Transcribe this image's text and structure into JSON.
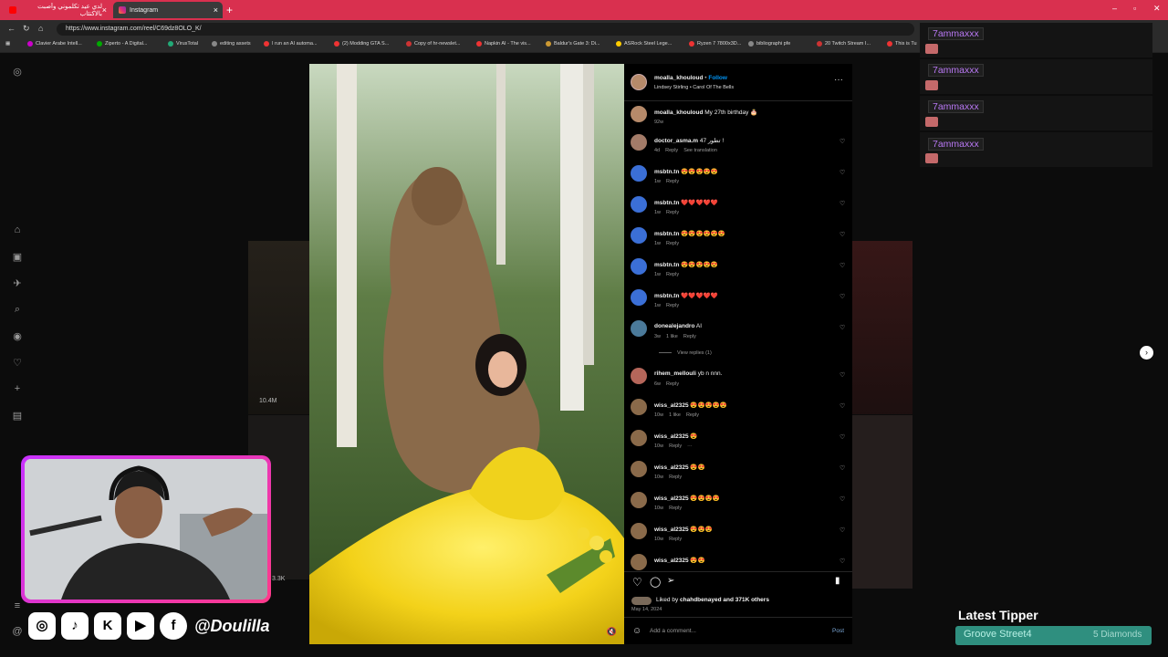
{
  "browser": {
    "tabs": [
      {
        "title": "لدي عيد تكلموني وأصبت بالاكتئاب"
      },
      {
        "title": "Instagram"
      }
    ],
    "url": "https://www.instagram.com/reel/C69dz8OLO_K/",
    "bookmarks": [
      "Clavier Arabe Intell...",
      "Ziperto - A Digital...",
      "VirusTotal",
      "editing assets",
      "I run an AI automa...",
      "(2) Modding GTA S...",
      "Copy of hr-newslet...",
      "Napkin AI - The vis...",
      "Baldur's Gate 3: Di...",
      "ASRock Steel Lege...",
      "Ryzen 7 7800x3D...",
      "bibliographi pfe",
      "20 Twitch Stream I...",
      "This is Tu"
    ]
  },
  "reel": {
    "author": "moalla_khouloud",
    "follow_label": "Follow",
    "audio": "Lindsey Stirling • Carol Of The Bells",
    "caption": {
      "user": "moalla_khouloud",
      "text": "My 27th birthday 🎂",
      "time": "92w"
    },
    "comments": [
      {
        "user": "doctor_asma.m",
        "text": "تطور 47 !",
        "time": "4d",
        "actions": [
          "Reply",
          "See translation"
        ]
      },
      {
        "user": "msbtn.tn",
        "text": "😍😍😍😍😍",
        "time": "1w",
        "actions": [
          "Reply"
        ]
      },
      {
        "user": "msbtn.tn",
        "text": "❤️❤️❤️❤️❤️",
        "time": "1w",
        "actions": [
          "Reply"
        ]
      },
      {
        "user": "msbtn.tn",
        "text": "😍😍😍😍😍😍",
        "time": "1w",
        "actions": [
          "Reply"
        ]
      },
      {
        "user": "msbtn.tn",
        "text": "😍😍😍😍😍",
        "time": "1w",
        "actions": [
          "Reply"
        ]
      },
      {
        "user": "msbtn.tn",
        "text": "❤️❤️❤️❤️❤️",
        "time": "1w",
        "actions": [
          "Reply"
        ]
      },
      {
        "user": "donealejandro",
        "text": "AI",
        "time": "3w",
        "actions": [
          "1 like",
          "Reply"
        ],
        "view_replies": "View replies (1)"
      },
      {
        "user": "rihem_mellouli",
        "text": "yb n nnn.",
        "time": "6w",
        "actions": [
          "Reply"
        ]
      },
      {
        "user": "wiss_al2325",
        "text": "😍😍😍😍😍",
        "time": "10w",
        "actions": [
          "1 like",
          "Reply"
        ]
      },
      {
        "user": "wiss_al2325",
        "text": "😍",
        "time": "10w",
        "actions": [
          "Reply",
          "···"
        ]
      },
      {
        "user": "wiss_al2325",
        "text": "😍😍",
        "time": "10w",
        "actions": [
          "Reply"
        ]
      },
      {
        "user": "wiss_al2325",
        "text": "😍😍😍😍",
        "time": "10w",
        "actions": [
          "Reply"
        ]
      },
      {
        "user": "wiss_al2325",
        "text": "😍😍😍",
        "time": "10w",
        "actions": [
          "Reply"
        ]
      },
      {
        "user": "wiss_al2325",
        "text": "😍😍",
        "time": "",
        "actions": []
      }
    ],
    "liked_by_prefix": "Liked by",
    "liked_by_user": "chahdbenayed",
    "liked_by_suffix": "and 371K others",
    "date": "May 14, 2024",
    "add_comment_placeholder": "Add a comment...",
    "post_label": "Post"
  },
  "feed": {
    "views_left": "10.4M",
    "views_left2": "3.3K"
  },
  "stream": {
    "chat": [
      {
        "name": "7ammaxxx"
      },
      {
        "name": "7ammaxxx"
      },
      {
        "name": "7ammaxxx"
      },
      {
        "name": "7ammaxxx"
      }
    ],
    "handle": "@Doulilla",
    "latest_tipper_title": "Latest Tipper",
    "tipper_name": "Groove Street4",
    "tipper_amount": "5 Diamonds"
  },
  "colors": {
    "tab_bar": "#d9304f",
    "follow": "#0095f6",
    "chat_name": "#b978f4",
    "tipper_box": "#2f8f7f"
  }
}
